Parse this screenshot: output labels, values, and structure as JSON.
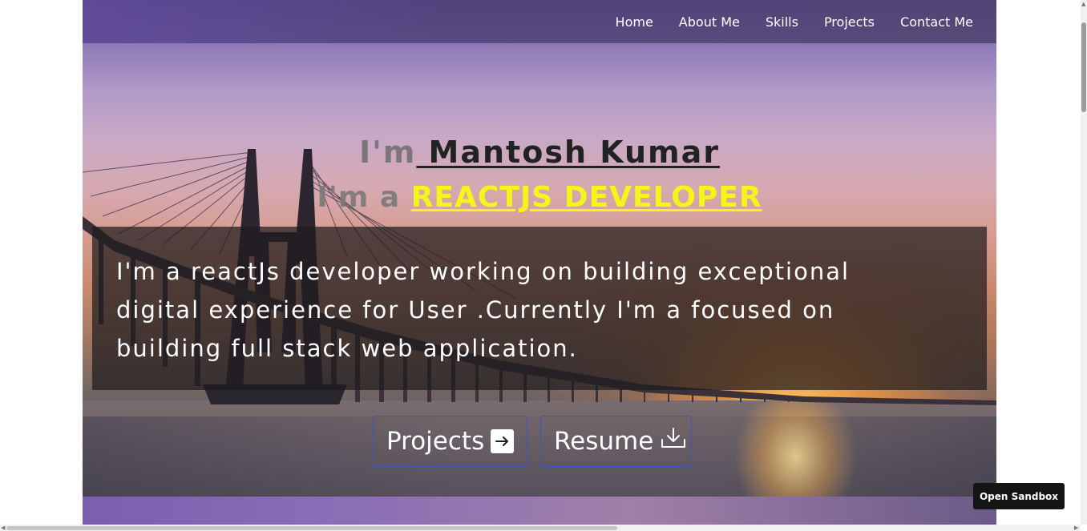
{
  "nav": {
    "items": [
      {
        "label": "Home"
      },
      {
        "label": "About Me"
      },
      {
        "label": "Skills"
      },
      {
        "label": "Projects"
      },
      {
        "label": "Contact Me"
      }
    ]
  },
  "hero": {
    "name_prefix": "I'm",
    "name": " Mantosh Kumar",
    "role_prefix": "I'm a ",
    "role": "REACTJS DEVELOPER",
    "about": "I'm a reactJs developer working on building exceptional digital experience for User .Currently I'm a focused on building full stack web application.",
    "projects_button": "Projects",
    "resume_button": "Resume"
  },
  "sandbox": {
    "button_label": "Open Sandbox"
  },
  "colors": {
    "role_highlight": "#f5f51a",
    "button_border": "#3d56b8",
    "about_overlay": "rgba(30,28,30,0.72)"
  },
  "icons": {
    "projects": "arrow-right-icon",
    "resume": "download-icon"
  }
}
